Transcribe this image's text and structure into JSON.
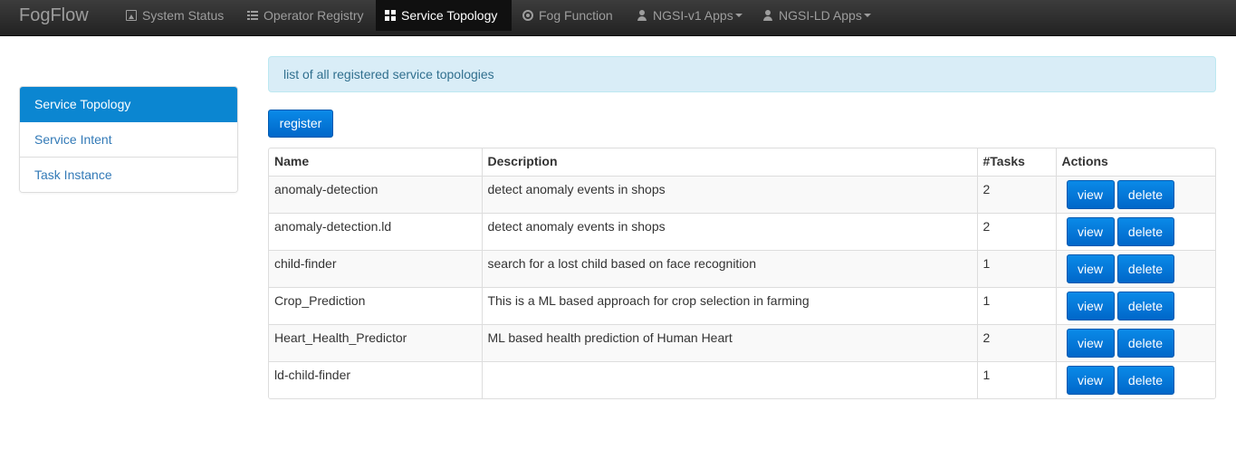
{
  "navbar": {
    "brand": "FogFlow",
    "items": [
      {
        "label": "System Status",
        "icon": "picture-icon",
        "active": false
      },
      {
        "label": "Operator Registry",
        "icon": "list-icon",
        "active": false
      },
      {
        "label": "Service Topology",
        "icon": "grid-icon",
        "active": true
      },
      {
        "label": "Fog Function",
        "icon": "record-icon",
        "active": false
      },
      {
        "label": "NGSI-v1 Apps",
        "icon": "user-icon",
        "active": false,
        "dropdown": true
      },
      {
        "label": "NGSI-LD Apps",
        "icon": "user-icon",
        "active": false,
        "dropdown": true
      }
    ]
  },
  "sidebar": {
    "items": [
      {
        "label": "Service Topology",
        "active": true
      },
      {
        "label": "Service Intent",
        "active": false
      },
      {
        "label": "Task Instance",
        "active": false
      }
    ]
  },
  "main": {
    "info_text": "list of all registered service topologies",
    "register_label": "register",
    "table": {
      "headers": [
        "Name",
        "Description",
        "#Tasks",
        "Actions"
      ],
      "rows": [
        {
          "name": "anomaly-detection",
          "description": "detect anomaly events in shops",
          "tasks": "2"
        },
        {
          "name": "anomaly-detection.ld",
          "description": "detect anomaly events in shops",
          "tasks": "2"
        },
        {
          "name": "child-finder",
          "description": "search for a lost child based on face recognition",
          "tasks": "1"
        },
        {
          "name": "Crop_Prediction",
          "description": "This is a ML based approach for crop selection in farming",
          "tasks": "1"
        },
        {
          "name": "Heart_Health_Predictor",
          "description": "ML based health prediction of Human Heart",
          "tasks": "2"
        },
        {
          "name": "ld-child-finder",
          "description": "",
          "tasks": "1"
        }
      ],
      "view_label": "view",
      "delete_label": "delete"
    }
  },
  "colors": {
    "navbar_bg": "#222222",
    "accent": "#0b86d1",
    "button": "#0a7ad6",
    "info_bg": "#d9edf7",
    "info_text": "#31708f"
  }
}
